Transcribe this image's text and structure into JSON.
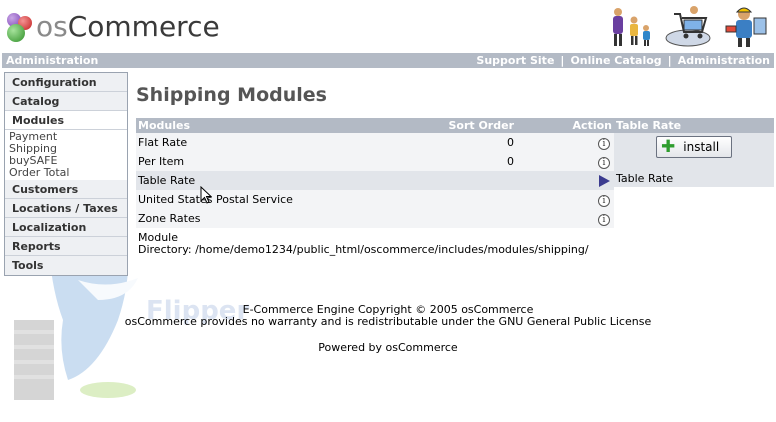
{
  "header": {
    "logo_prefix": "os",
    "logo_main": "Commerce",
    "icons": [
      "family-icon",
      "shopping-cart-icon",
      "support-worker-icon"
    ]
  },
  "navbar": {
    "left": "Administration",
    "links": [
      "Support Site",
      "Online Catalog",
      "Administration"
    ],
    "separator": "|"
  },
  "sidebar": {
    "sections": [
      {
        "label": "Configuration",
        "sub": []
      },
      {
        "label": "Catalog",
        "sub": []
      },
      {
        "label": "Modules",
        "sub": [
          "Payment",
          "Shipping",
          "buySAFE",
          "Order Total"
        ]
      },
      {
        "label": "Customers",
        "sub": []
      },
      {
        "label": "Locations / Taxes",
        "sub": []
      },
      {
        "label": "Localization",
        "sub": []
      },
      {
        "label": "Reports",
        "sub": []
      },
      {
        "label": "Tools",
        "sub": []
      }
    ]
  },
  "main": {
    "title": "Shipping Modules",
    "columns": {
      "modules": "Modules",
      "sort_order": "Sort Order",
      "action": "Action"
    },
    "rows": [
      {
        "name": "Flat Rate",
        "sort": "0",
        "action": "info"
      },
      {
        "name": "Per Item",
        "sort": "0",
        "action": "info"
      },
      {
        "name": "Table Rate",
        "sort": "",
        "action": "selected"
      },
      {
        "name": "United States Postal Service",
        "sort": "",
        "action": "info"
      },
      {
        "name": "Zone Rates",
        "sort": "",
        "action": "info"
      }
    ],
    "module_directory_label": "Module",
    "module_directory": "Directory: /home/demo1234/public_html/oscommerce/includes/modules/shipping/"
  },
  "right_panel": {
    "heading": "Table Rate",
    "install_label": "install",
    "title": "Table Rate"
  },
  "watermark": "Flipper",
  "footer": {
    "line1": "E-Commerce Engine Copyright © 2005 osCommerce",
    "line2": "osCommerce provides no warranty and is redistributable under the GNU General Public License",
    "powered": "Powered by osCommerce"
  },
  "colors": {
    "bar": "#b3bac5",
    "row_selected": "#e2e5ea",
    "title": "#555555"
  }
}
